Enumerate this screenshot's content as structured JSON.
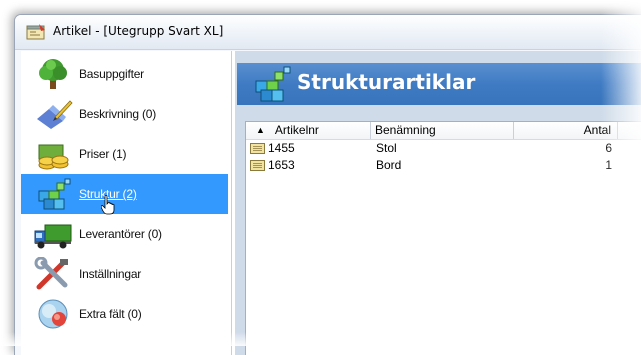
{
  "window": {
    "title": "Artikel - [Utegrupp Svart XL]",
    "app_icon": "app-window-icon"
  },
  "sidebar": {
    "items": [
      {
        "label": "Basuppgifter",
        "icon": "tree-icon",
        "selected": false
      },
      {
        "label": "Beskrivning  (0)",
        "icon": "pen-icon",
        "selected": false
      },
      {
        "label": "Priser  (1)",
        "icon": "coins-icon",
        "selected": false
      },
      {
        "label": "Struktur  (2)",
        "icon": "structure-cubes-icon",
        "selected": true
      },
      {
        "label": "Leverantörer  (0)",
        "icon": "truck-icon",
        "selected": false
      },
      {
        "label": "Inställningar",
        "icon": "tools-icon",
        "selected": false
      },
      {
        "label": "Extra fält  (0)",
        "icon": "extra-fields-icon",
        "selected": false
      }
    ]
  },
  "content": {
    "header_title": "Strukturartiklar",
    "header_icon": "structure-cubes-icon",
    "list": {
      "columns": [
        "Artikelnr",
        "Benämning",
        "Antal"
      ],
      "sort_column": "Artikelnr",
      "sort_direction": "ascending",
      "rows": [
        {
          "artikelnr": "1455",
          "benamning": "Stol",
          "antal": "6"
        },
        {
          "artikelnr": "1653",
          "benamning": "Bord",
          "antal": "1"
        }
      ]
    }
  },
  "colors": {
    "selection": "#3399ff",
    "header_band": "#3f7bc3",
    "content_background": "#cfdbe9"
  }
}
